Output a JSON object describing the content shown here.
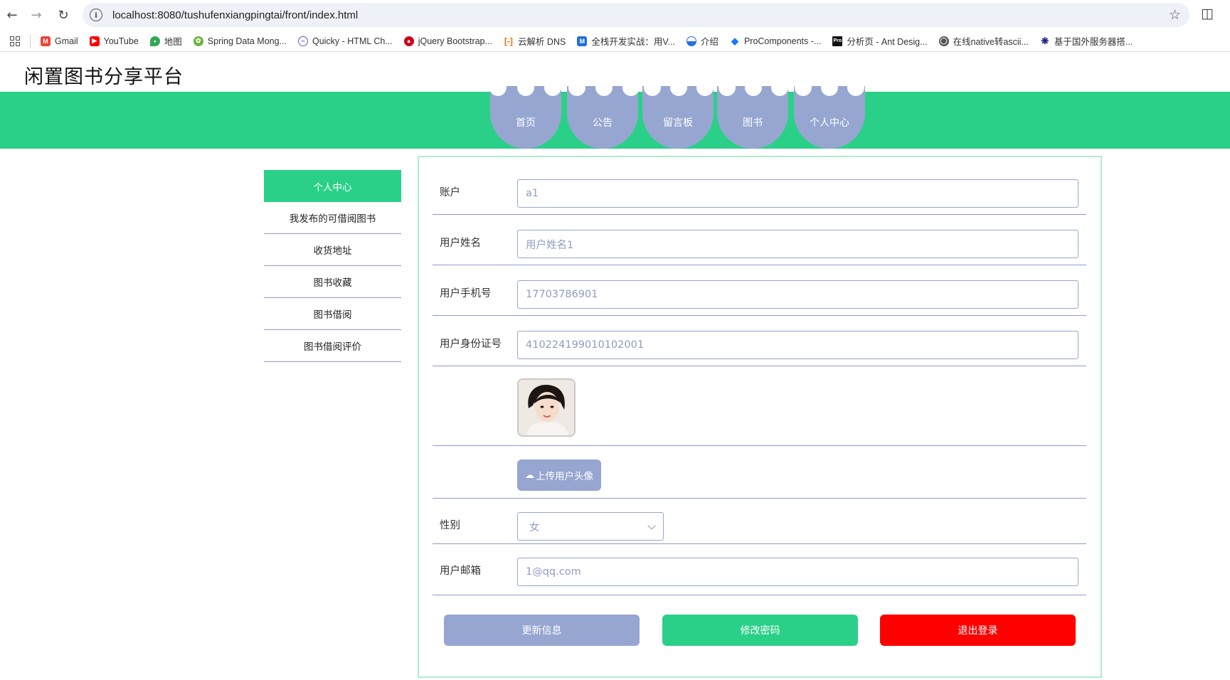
{
  "browser": {
    "url": "localhost:8080/tushufenxiangpingtai/front/index.html",
    "bookmarks": [
      {
        "label": "Gmail",
        "icon": "gmail-icon",
        "color": "#ea4335"
      },
      {
        "label": "YouTube",
        "icon": "youtube-icon",
        "color": "#ff0000"
      },
      {
        "label": "地图",
        "icon": "maps-icon",
        "color": "#34a853"
      },
      {
        "label": "Spring Data Mong...",
        "icon": "spring-icon",
        "color": "#6db33f"
      },
      {
        "label": "Quicky - HTML Ch...",
        "icon": "quicky-icon",
        "color": "#5b5bd6"
      },
      {
        "label": "jQuery Bootstrap...",
        "icon": "jquery-icon",
        "color": "#d0021b"
      },
      {
        "label": "云解析 DNS",
        "icon": "aliyun-icon",
        "color": "#ff6a00"
      },
      {
        "label": "全栈开发实战：用V...",
        "icon": "medium-icon",
        "color": "#1e6fd9"
      },
      {
        "label": "介绍",
        "icon": "globe-half-icon",
        "color": "#2a6fdb"
      },
      {
        "label": "ProComponents -...",
        "icon": "procomponents-icon",
        "color": "#1677ff"
      },
      {
        "label": "分析页 - Ant Desig...",
        "icon": "pro-icon",
        "color": "#111111"
      },
      {
        "label": "在线native转ascii...",
        "icon": "globe-icon",
        "color": "#555555"
      },
      {
        "label": "基于国外服务器搭...",
        "icon": "fan-icon",
        "color": "#1a237e"
      }
    ]
  },
  "site": {
    "title": "闲置图书分享平台",
    "nav": [
      "首页",
      "公告",
      "留言板",
      "图书",
      "个人中心"
    ],
    "sidebar": [
      "个人中心",
      "我发布的可借阅图书",
      "收货地址",
      "图书收藏",
      "图书借阅",
      "图书借阅评价"
    ]
  },
  "form": {
    "account_label": "账户",
    "account_value": "a1",
    "name_label": "用户姓名",
    "name_value": "用户姓名1",
    "phone_label": "用户手机号",
    "phone_value": "17703786901",
    "id_label": "用户身份证号",
    "id_value": "410224199010102001",
    "upload_label": "上传用户头像",
    "gender_label": "性别",
    "gender_value": "女",
    "email_label": "用户邮箱",
    "email_value": "1@qq.com"
  },
  "actions": {
    "update": "更新信息",
    "change_password": "修改密码",
    "logout": "退出登录"
  },
  "colors": {
    "brand_green": "#2bd088",
    "accent_blue": "#96a6d1",
    "danger_red": "#ff0000"
  }
}
